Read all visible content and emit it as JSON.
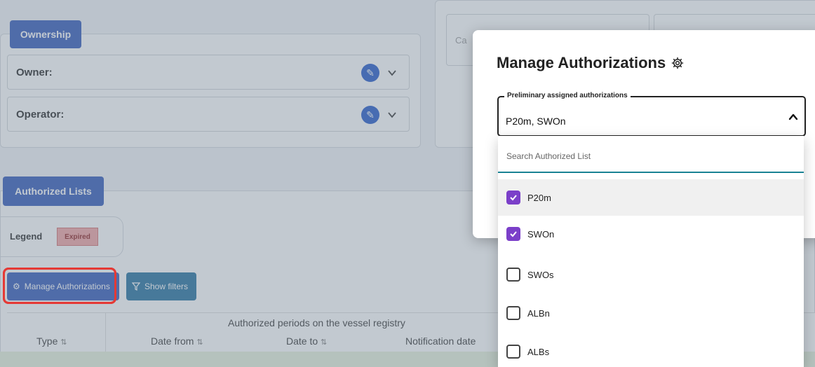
{
  "ownership": {
    "section_label": "Ownership",
    "owner_label": "Owner:",
    "operator_label": "Operator:"
  },
  "right_panel": {
    "partial_field": "Ca"
  },
  "authorized_lists": {
    "section_label": "Authorized Lists",
    "legend_label": "Legend",
    "expired_badge": "Expired",
    "manage_button": "Manage Authorizations",
    "filters_button": "Show filters",
    "table": {
      "group_header": "Authorized periods on the vessel registry",
      "columns": [
        "Type",
        "Date from",
        "Date to",
        "Notification date"
      ]
    }
  },
  "modal": {
    "title": "Manage Authorizations",
    "select_label": "Preliminary assigned authorizations",
    "select_value": "P20m, SWOn",
    "search_placeholder": "Search Authorized List",
    "options": [
      {
        "label": "P20m",
        "checked": true
      },
      {
        "label": "SWOn",
        "checked": true
      },
      {
        "label": "SWOs",
        "checked": false
      },
      {
        "label": "ALBn",
        "checked": false
      },
      {
        "label": "ALBs",
        "checked": false
      }
    ]
  },
  "colors": {
    "primary": "#2f56b8",
    "checkbox": "#7b3fc9",
    "highlight": "#e53935",
    "search_underline": "#1a8293"
  }
}
